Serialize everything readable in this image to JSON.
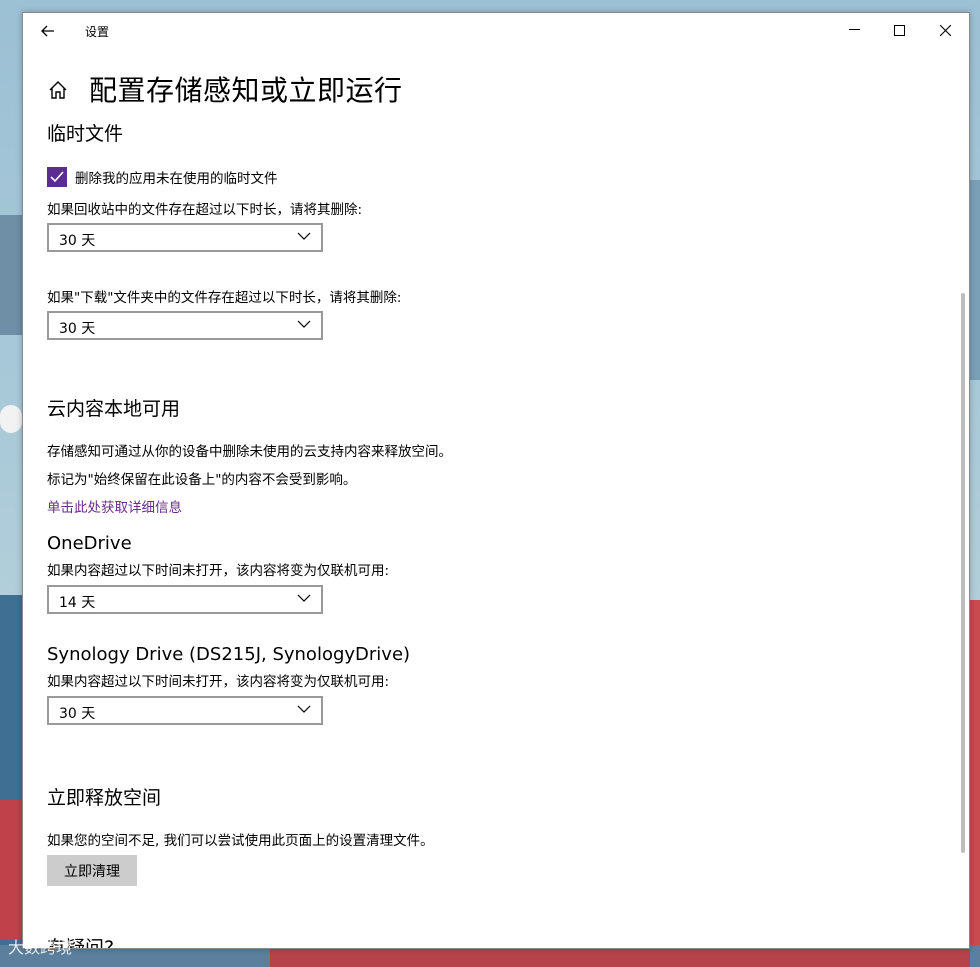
{
  "window": {
    "app_title": "设置"
  },
  "page": {
    "title": "配置存储感知或立即运行"
  },
  "temp_files": {
    "heading": "临时文件",
    "delete_checkbox_label": "删除我的应用未在使用的临时文件",
    "delete_checked": true,
    "recycle_bin_label": "如果回收站中的文件存在超过以下时长，请将其删除:",
    "recycle_bin_value": "30 天",
    "downloads_label": "如果\"下载\"文件夹中的文件存在超过以下时长，请将其删除:",
    "downloads_value": "30 天"
  },
  "cloud": {
    "heading": "云内容本地可用",
    "desc1": "存储感知可通过从你的设备中删除未使用的云支持内容来释放空间。",
    "desc2": "标记为\"始终保留在此设备上\"的内容不会受到影响。",
    "link": "单击此处获取详细信息",
    "providers": [
      {
        "name": "OneDrive",
        "label": "如果内容超过以下时间未打开，该内容将变为仅联机可用:",
        "value": "14 天"
      },
      {
        "name": "Synology Drive (DS215J, SynologyDrive)",
        "label": "如果内容超过以下时间未打开，该内容将变为仅联机可用:",
        "value": "30 天"
      }
    ]
  },
  "free_space": {
    "heading": "立即释放空间",
    "desc": "如果您的空间不足, 我们可以尝试使用此页面上的设置清理文件。",
    "button": "立即清理"
  },
  "help": {
    "heading": "有疑问?"
  },
  "watermark": "大数跨境",
  "colors": {
    "accent": "#5c2d91",
    "link": "#6a2b8e",
    "button_bg": "#cccccc"
  }
}
